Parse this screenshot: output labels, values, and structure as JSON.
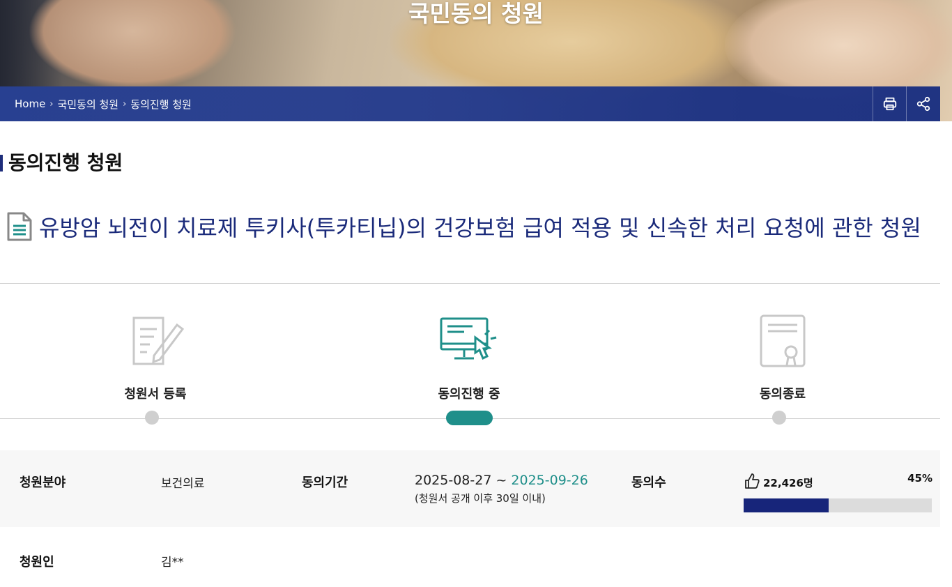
{
  "hero": {
    "title": "국민동의 청원"
  },
  "breadcrumb": {
    "items": [
      "Home",
      "국민동의 청원",
      "동의진행 청원"
    ]
  },
  "toolbar": {
    "print_icon": "printer-icon",
    "share_icon": "share-icon"
  },
  "section": {
    "title": "동의진행 청원"
  },
  "petition": {
    "title": "유방암 뇌전이 치료제 투키사(투카티닙)의 건강보험 급여 적용 및 신속한 처리 요청에 관한 청원"
  },
  "steps": [
    {
      "label": "청원서 등록",
      "icon": "document-pen-icon",
      "state": "done"
    },
    {
      "label": "동의진행 중",
      "icon": "monitor-click-icon",
      "state": "active"
    },
    {
      "label": "동의종료",
      "icon": "certificate-icon",
      "state": "pending"
    }
  ],
  "info": {
    "field_label": "청원분야",
    "field_value": "보건의료",
    "period_label": "동의기간",
    "period_start": "2025-08-27 ~ ",
    "period_end": "2025-09-26",
    "period_note": "(청원서 공개 이후 30일 이내)",
    "agree_label": "동의수",
    "agree_count": "22,426명",
    "agree_percent_text": "45%",
    "agree_percent": 0.45,
    "petitioner_label": "청원인",
    "petitioner_value": "김**"
  },
  "colors": {
    "accent_teal": "#1f8f8a",
    "title_navy": "#1a2a7a",
    "progress_navy": "#17257a",
    "nav_blue": "#1e3a8f"
  }
}
